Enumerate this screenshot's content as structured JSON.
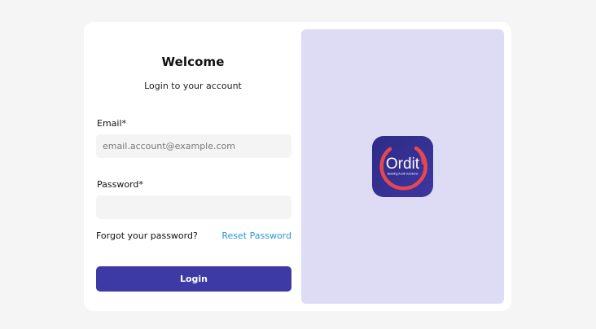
{
  "login": {
    "title": "Welcome",
    "subtitle": "Login to your account",
    "email": {
      "label": "Email*",
      "placeholder": "email.account@example.com",
      "value": ""
    },
    "password": {
      "label": "Password*",
      "placeholder": "",
      "value": ""
    },
    "forgot_text": "Forgot your password?",
    "reset_link": "Reset Password",
    "login_button": "Login"
  },
  "brand": {
    "logo_text": "Ordit",
    "logo_tagline": "Building Audit Solutions",
    "colors": {
      "logo_bg": "#35318f",
      "logo_ring": "#e8474f",
      "panel_bg": "#dedcf5",
      "button_bg": "#3d3aa5",
      "link": "#2a98d1"
    }
  }
}
